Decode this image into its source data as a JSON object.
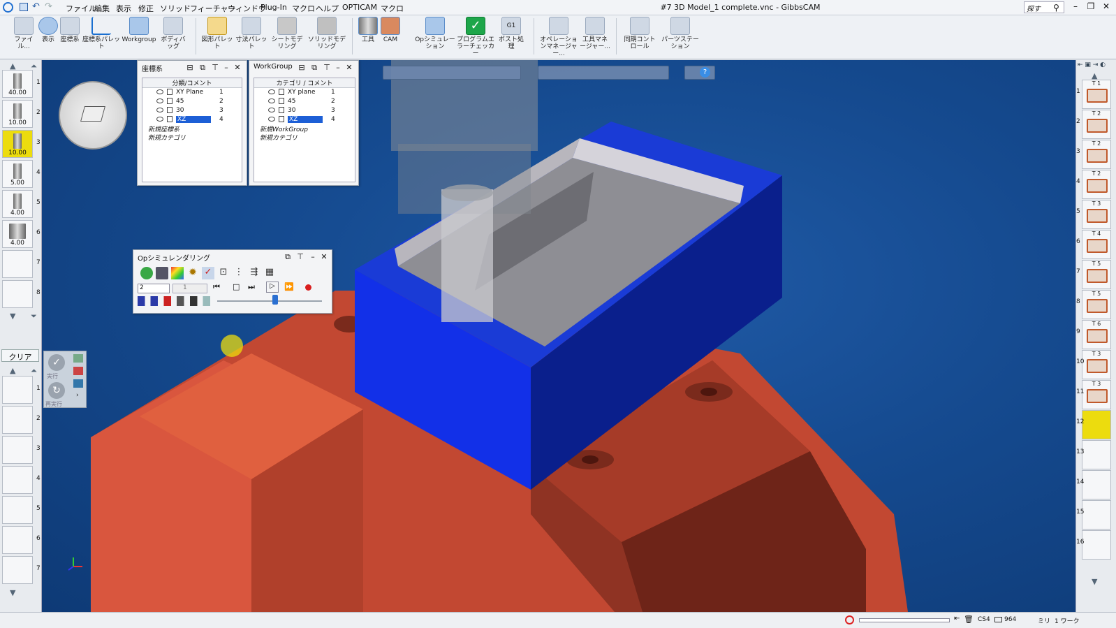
{
  "app": {
    "title": "#7 3D Model_1 complete.vnc - GibbsCAM",
    "search_placeholder": "探す"
  },
  "menu": [
    "ファイル",
    "編集",
    "表示",
    "修正",
    "ソリッド",
    "フィーチャー",
    "ウィンドウ",
    "Plug-In",
    "マクロ",
    "ヘルプ",
    "OPTICAM",
    "マクロ"
  ],
  "ribbon": {
    "buttons": [
      {
        "label": "ファイル..."
      },
      {
        "label": "表示"
      },
      {
        "label": "座標系"
      },
      {
        "label": "座標系パレット"
      },
      {
        "label": "Workgroup"
      },
      {
        "label": "ボディバッグ"
      },
      {
        "label": "図形パレット"
      },
      {
        "label": "寸法パレット"
      },
      {
        "label": "シートモデリング"
      },
      {
        "label": "ソリッドモデリング"
      },
      {
        "label": "工具"
      },
      {
        "label": "CAM"
      },
      {
        "label": "Opシミュレーション"
      },
      {
        "label": "プログラムエラーチェッカー"
      },
      {
        "label": "ポスト処理"
      },
      {
        "label": "オペレーションマネージャー..."
      },
      {
        "label": "工具マネージャー..."
      },
      {
        "label": "同期コントロール"
      },
      {
        "label": "パーツステーション"
      }
    ]
  },
  "cs_panel": {
    "title": "座標系",
    "header": "分類/コメント",
    "rows": [
      {
        "name": "XY Plane",
        "num": "1"
      },
      {
        "name": "45",
        "num": "2"
      },
      {
        "name": "30",
        "num": "3"
      },
      {
        "name": "XZ",
        "num": "4"
      }
    ],
    "new_items": [
      "新規座標系",
      "新規カテゴリ"
    ]
  },
  "wg_panel": {
    "title": "WorkGroup",
    "header": "カテゴリ / コメント",
    "rows": [
      {
        "name": "XY plane",
        "num": "1"
      },
      {
        "name": "45",
        "num": "2"
      },
      {
        "name": "30",
        "num": "3"
      },
      {
        "name": "XZ",
        "num": "4"
      }
    ],
    "new_items": [
      "新規WorkGroup",
      "新規カテゴリ"
    ]
  },
  "sim_panel": {
    "title": "Opシミュレンダリング",
    "field_value": "2",
    "field2_value": "1",
    "slider_level": 0.55
  },
  "left_tools": [
    {
      "num": "1",
      "val": "40.00"
    },
    {
      "num": "2",
      "val": "10.00"
    },
    {
      "num": "3",
      "val": "10.00",
      "active": true
    },
    {
      "num": "4",
      "val": "5.00"
    },
    {
      "num": "5",
      "val": "4.00"
    },
    {
      "num": "6",
      "val": "4.00"
    },
    {
      "num": "7",
      "val": ""
    },
    {
      "num": "8",
      "val": ""
    }
  ],
  "left_ops": {
    "clear_label": "クリア",
    "run_label": "実行",
    "redo_label": "再実行",
    "slots": [
      "1",
      "2",
      "3",
      "4",
      "5",
      "6",
      "7"
    ]
  },
  "right_tools": [
    {
      "num": "1",
      "tl": "T 1"
    },
    {
      "num": "2",
      "tl": "T 2"
    },
    {
      "num": "3",
      "tl": "T 2"
    },
    {
      "num": "4",
      "tl": "T 2"
    },
    {
      "num": "5",
      "tl": "T 3"
    },
    {
      "num": "6",
      "tl": "T 4"
    },
    {
      "num": "7",
      "tl": "T 5"
    },
    {
      "num": "8",
      "tl": "T 5"
    },
    {
      "num": "9",
      "tl": "T 6"
    },
    {
      "num": "10",
      "tl": "T 3"
    },
    {
      "num": "11",
      "tl": "T 3"
    },
    {
      "num": "12",
      "tl": "",
      "active": true
    },
    {
      "num": "13",
      "tl": ""
    },
    {
      "num": "14",
      "tl": ""
    },
    {
      "num": "15",
      "tl": ""
    },
    {
      "num": "16",
      "tl": ""
    }
  ],
  "status": {
    "cs": "CS4",
    "count": "964",
    "unit": "ミリ",
    "mode": "1 ワーク"
  },
  "colors": {
    "viewport_bg": "#154a8f",
    "workpiece": "#1f3fe0",
    "vise": "#d4513a",
    "active_slot": "#ecdc0e"
  }
}
